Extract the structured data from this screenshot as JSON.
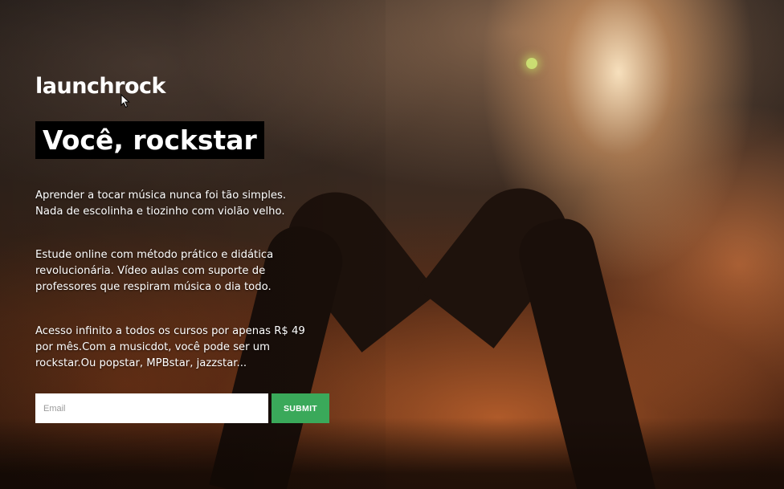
{
  "brand": {
    "logo_text": "launchrock"
  },
  "hero": {
    "headline": "Você, rockstar",
    "paragraph_1_line_1": "Aprender a tocar música nunca foi tão simples.",
    "paragraph_1_line_2": "Nada de escolinha e tiozinho com violão velho.",
    "paragraph_2_line_1": "Estude online com método prático e didática",
    "paragraph_2_line_2": "revolucionária. Vídeo aulas com suporte de",
    "paragraph_2_line_3": "professores que respiram música o dia todo.",
    "paragraph_3_line_1": "Acesso infinito a todos os cursos por apenas R$ 49",
    "paragraph_3_line_2": "por mês.Com a musicdot, você pode ser um",
    "paragraph_3_line_3": "rockstar.Ou popstar, MPBstar, jazzstar..."
  },
  "signup": {
    "email_placeholder": "Email",
    "email_value": "",
    "submit_label": "SUBMIT",
    "submit_color": "#3aa95a"
  },
  "icons": {
    "cursor": "mouse-pointer-icon"
  }
}
